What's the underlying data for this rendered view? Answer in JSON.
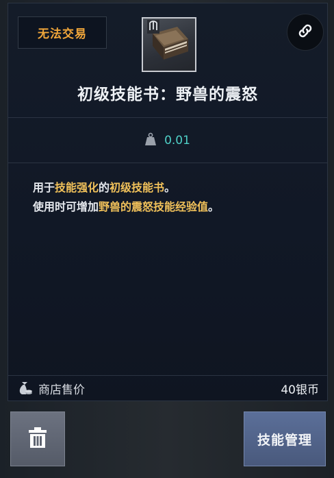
{
  "item": {
    "trade_status": "无法交易",
    "name": "初级技能书：野兽的震怒",
    "weight": "0.01",
    "description": {
      "line1": {
        "a": "用于",
        "b": "技能强化",
        "c": "的",
        "d": "初级技能书",
        "e": "。"
      },
      "line2": {
        "a": "使用时可增加",
        "b": "野兽的震怒技能经验值",
        "c": "。"
      }
    }
  },
  "price": {
    "label": "商店售价",
    "value": "40银币"
  },
  "buttons": {
    "skill_manage": "技能管理"
  },
  "icons": {
    "link": "link-icon",
    "item": "skill-book-icon",
    "weight": "weight-icon",
    "coin": "coin-bag-icon",
    "trash": "trash-icon"
  },
  "colors": {
    "trade_status": "#f0a63a",
    "highlight": "#f1c15a",
    "weight_value": "#4fd1c8",
    "primary_button": "#5b6f99"
  }
}
